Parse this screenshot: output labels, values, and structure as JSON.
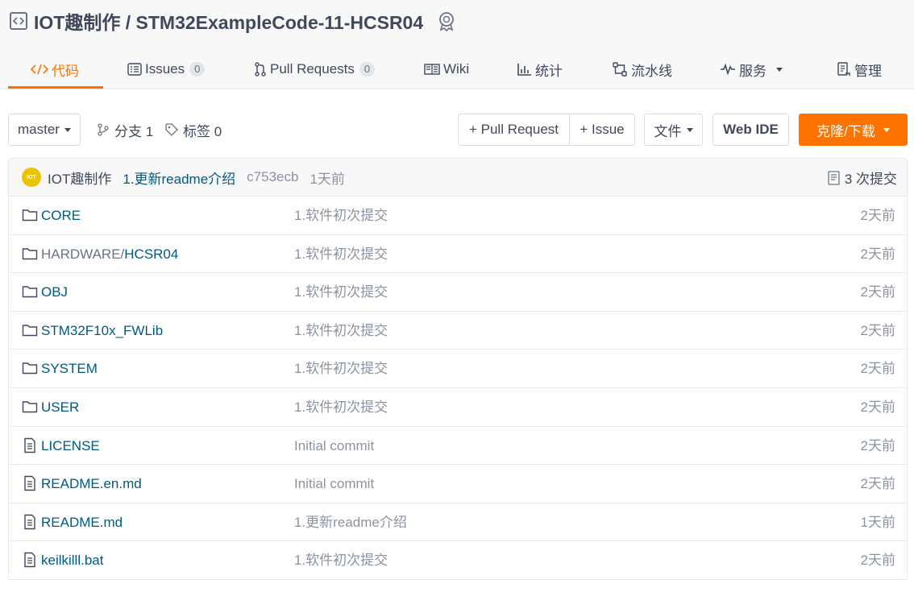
{
  "repo": {
    "owner": "IOT趣制作",
    "separator": " / ",
    "name": "STM32ExampleCode-11-HCSR04"
  },
  "tabs": [
    {
      "label": "代码",
      "icon": "code-icon",
      "active": true
    },
    {
      "label": "Issues",
      "icon": "issues-icon",
      "count": "0"
    },
    {
      "label": "Pull Requests",
      "icon": "pull-request-icon",
      "count": "0"
    },
    {
      "label": "Wiki",
      "icon": "wiki-icon"
    },
    {
      "label": "统计",
      "icon": "chart-icon"
    },
    {
      "label": "流水线",
      "icon": "pipeline-icon"
    },
    {
      "label": "服务",
      "icon": "pulse-icon",
      "dropdown": true
    },
    {
      "label": "管理",
      "icon": "manage-icon"
    }
  ],
  "toolbar": {
    "branch": "master",
    "branches": "分支 1",
    "tags": "标签 0",
    "pull_request": "+ Pull Request",
    "issue": "+ Issue",
    "file": "文件",
    "web_ide": "Web IDE",
    "clone": "克隆/下载"
  },
  "commit": {
    "avatar_text": "IOT",
    "author": "IOT趣制作",
    "message": "1.更新readme介绍",
    "sha": "c753ecb",
    "time": "1天前",
    "count": "3 次提交"
  },
  "files": [
    {
      "type": "folder",
      "prefix": "",
      "name": "CORE",
      "message": "1.软件初次提交",
      "time": "2天前"
    },
    {
      "type": "folder",
      "prefix": "HARDWARE/",
      "name": "HCSR04",
      "message": "1.软件初次提交",
      "time": "2天前"
    },
    {
      "type": "folder",
      "prefix": "",
      "name": "OBJ",
      "message": "1.软件初次提交",
      "time": "2天前"
    },
    {
      "type": "folder",
      "prefix": "",
      "name": "STM32F10x_FWLib",
      "message": "1.软件初次提交",
      "time": "2天前"
    },
    {
      "type": "folder",
      "prefix": "",
      "name": "SYSTEM",
      "message": "1.软件初次提交",
      "time": "2天前"
    },
    {
      "type": "folder",
      "prefix": "",
      "name": "USER",
      "message": "1.软件初次提交",
      "time": "2天前"
    },
    {
      "type": "file",
      "prefix": "",
      "name": "LICENSE",
      "message": "Initial commit",
      "time": "2天前"
    },
    {
      "type": "file",
      "prefix": "",
      "name": "README.en.md",
      "message": "Initial commit",
      "time": "2天前"
    },
    {
      "type": "file",
      "prefix": "",
      "name": "README.md",
      "message": "1.更新readme介绍",
      "time": "1天前"
    },
    {
      "type": "file",
      "prefix": "",
      "name": "keilkilll.bat",
      "message": "1.软件初次提交",
      "time": "2天前"
    }
  ],
  "colors": {
    "accent": "#fe7300",
    "link": "#005980",
    "muted": "#8c92a4"
  }
}
